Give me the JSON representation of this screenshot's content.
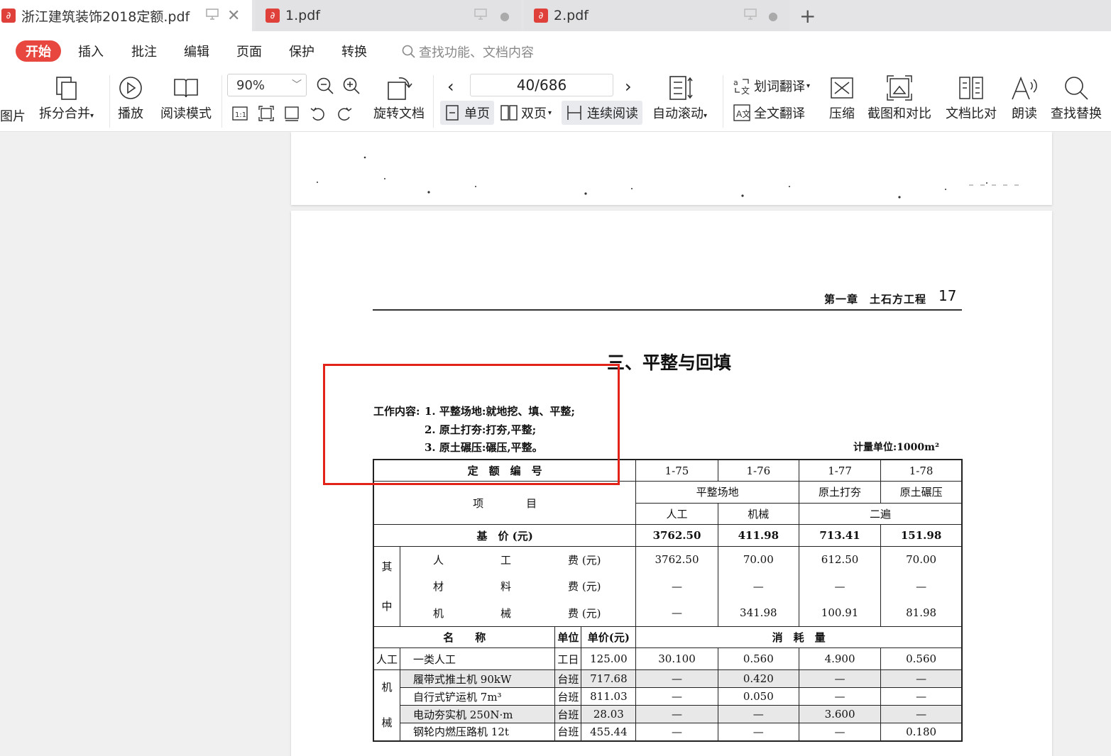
{
  "tabs": [
    {
      "label": "浙江建筑装饰2018定额.pdf",
      "active": true
    },
    {
      "label": "1.pdf",
      "active": false
    },
    {
      "label": "2.pdf",
      "active": false
    }
  ],
  "new_tab_icon": "plus-icon",
  "menu": {
    "start": "开始",
    "items": [
      "插入",
      "批注",
      "编辑",
      "页面",
      "保护",
      "转换"
    ],
    "search_placeholder": "查找功能、文档内容"
  },
  "toolbar": {
    "img_label": "图片",
    "split_merge": "拆分合并",
    "play": "播放",
    "read_mode": "阅读模式",
    "zoom": "90%",
    "rotate": "旋转文档",
    "page": "40/686",
    "single": "单页",
    "double": "双页",
    "continuous": "连续阅读",
    "auto_scroll": "自动滚动",
    "word_translate": "划词翻译",
    "full_translate": "全文翻译",
    "compress": "压缩",
    "screenshot_compare": "截图和对比",
    "doc_compare": "文档比对",
    "read_aloud": "朗读",
    "find_replace": "查找替换"
  },
  "document": {
    "header": "第一章　土石方工程",
    "page_num": "17",
    "section_title": "三、平整与回填",
    "work_label": "工作内容:",
    "work_items": [
      "1. 平整场地:就地挖、填、平整;",
      "2. 原土打夯:打夯,平整;",
      "3. 原土碾压:碾压,平整。"
    ],
    "unit": "计量单位:1000m²",
    "table": {
      "quota_no_label": "定　额　编　号",
      "codes": [
        "1-75",
        "1-76",
        "1-77",
        "1-78"
      ],
      "item_label": "项　　　　目",
      "groups": [
        "平整场地",
        "原土打夯",
        "原土碾压"
      ],
      "subs": [
        "人工",
        "机械",
        "二遍"
      ],
      "base_price_label": "基　价 (元)",
      "base_prices": [
        "3762.50",
        "411.98",
        "713.41",
        "151.98"
      ],
      "qi": "其",
      "zhong": "中",
      "cost_rows": [
        {
          "a": "人",
          "b": "工",
          "c": "费 (元)",
          "v": [
            "3762.50",
            "70.00",
            "612.50",
            "70.00"
          ]
        },
        {
          "a": "材",
          "b": "料",
          "c": "费 (元)",
          "v": [
            "—",
            "—",
            "—",
            "—"
          ]
        },
        {
          "a": "机",
          "b": "械",
          "c": "费 (元)",
          "v": [
            "—",
            "341.98",
            "100.91",
            "81.98"
          ]
        }
      ],
      "name_label": "名　　称",
      "unit_label": "单位",
      "unit_price_label": "单价(元)",
      "consume_label": "消　耗　量",
      "labor_cat": "人工",
      "labor_row": {
        "name": "一类人工",
        "unit": "工日",
        "price": "125.00",
        "v": [
          "30.100",
          "0.560",
          "4.900",
          "0.560"
        ]
      },
      "mech_cat_top": "机",
      "mech_cat_bottom": "械",
      "mech_rows": [
        {
          "name": "履带式推土机 90kW",
          "unit": "台班",
          "price": "717.68",
          "v": [
            "—",
            "0.420",
            "—",
            "—"
          ]
        },
        {
          "name": "自行式铲运机 7m³",
          "unit": "台班",
          "price": "811.03",
          "v": [
            "—",
            "0.050",
            "—",
            "—"
          ]
        },
        {
          "name": "电动夯实机 250N·m",
          "unit": "台班",
          "price": "28.03",
          "v": [
            "—",
            "—",
            "3.600",
            "—"
          ]
        },
        {
          "name": "钢轮内燃压路机 12t",
          "unit": "台班",
          "price": "455.44",
          "v": [
            "—",
            "—",
            "—",
            "0.180"
          ]
        }
      ]
    }
  },
  "colors": {
    "accent": "#e8473f",
    "highlight_box": "#e2231a"
  }
}
